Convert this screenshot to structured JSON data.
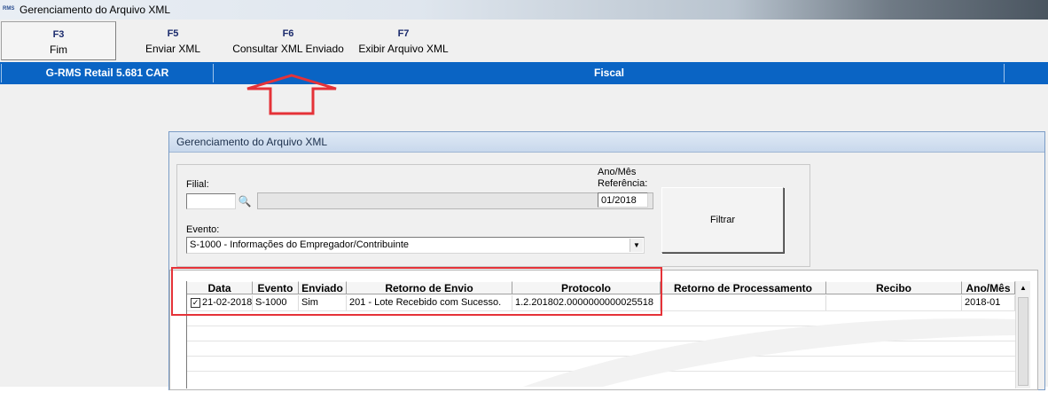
{
  "window": {
    "title": "Gerenciamento do Arquivo XML",
    "app_icon": "RMS"
  },
  "toolbar": {
    "buttons": [
      {
        "key": "F3",
        "label": "Fim"
      },
      {
        "key": "F5",
        "label": "Enviar XML"
      },
      {
        "key": "F6",
        "label": "Consultar XML Enviado"
      },
      {
        "key": "F7",
        "label": "Exibir Arquivo XML"
      }
    ]
  },
  "statusbar": {
    "app": "G-RMS Retail 5.681 CAR",
    "module": "Fiscal"
  },
  "dialog": {
    "title": "Gerenciamento do Arquivo XML",
    "filial_label": "Filial:",
    "filial_value": "",
    "filial_search_icon": "binoculars-icon",
    "ano_mes_label_1": "Ano/Mês",
    "ano_mes_label_2": "Referência:",
    "ano_mes_value": "01/2018",
    "evento_label": "Evento:",
    "evento_value": "S-1000 - Informações do Empregador/Contribuinte",
    "filtrar_label": "Filtrar"
  },
  "grid": {
    "columns": [
      "Data",
      "Evento",
      "Enviado",
      "Retorno de Envio",
      "Protocolo",
      "Retorno de Processamento",
      "Recibo",
      "Ano/Mês"
    ],
    "rows": [
      {
        "checked": true,
        "data": "21-02-2018",
        "evento": "S-1000",
        "enviado": "Sim",
        "retorno_envio": "201 - Lote Recebido com Sucesso.",
        "protocolo": "1.2.201802.0000000000025518",
        "retorno_processamento": "",
        "recibo": "",
        "ano_mes": "2018-01"
      }
    ]
  },
  "colors": {
    "statusbar_blue": "#0a64c4",
    "annotation_red": "#e53238"
  }
}
